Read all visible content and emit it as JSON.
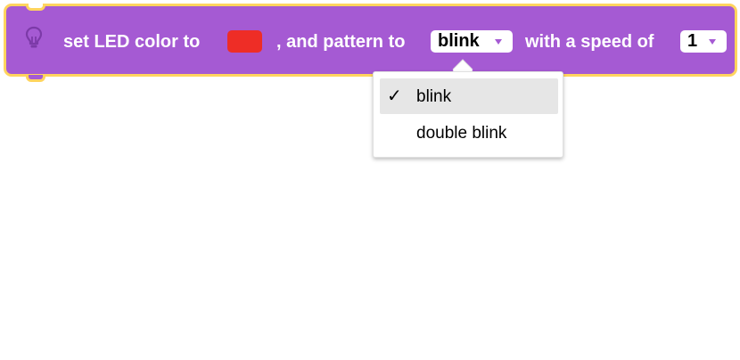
{
  "block": {
    "text_before_color": "set LED color to",
    "text_before_pattern": ", and pattern to",
    "text_before_speed": "with a speed of",
    "color_value": "#ee2d26",
    "pattern_value": "blink",
    "speed_value": "1",
    "icon": "lightbulb-icon",
    "block_color": "#a55ad3",
    "outline_color": "#ffd45e"
  },
  "pattern_menu": {
    "items": [
      {
        "label": "blink",
        "selected": true,
        "check": "✓"
      },
      {
        "label": "double blink",
        "selected": false
      }
    ]
  }
}
